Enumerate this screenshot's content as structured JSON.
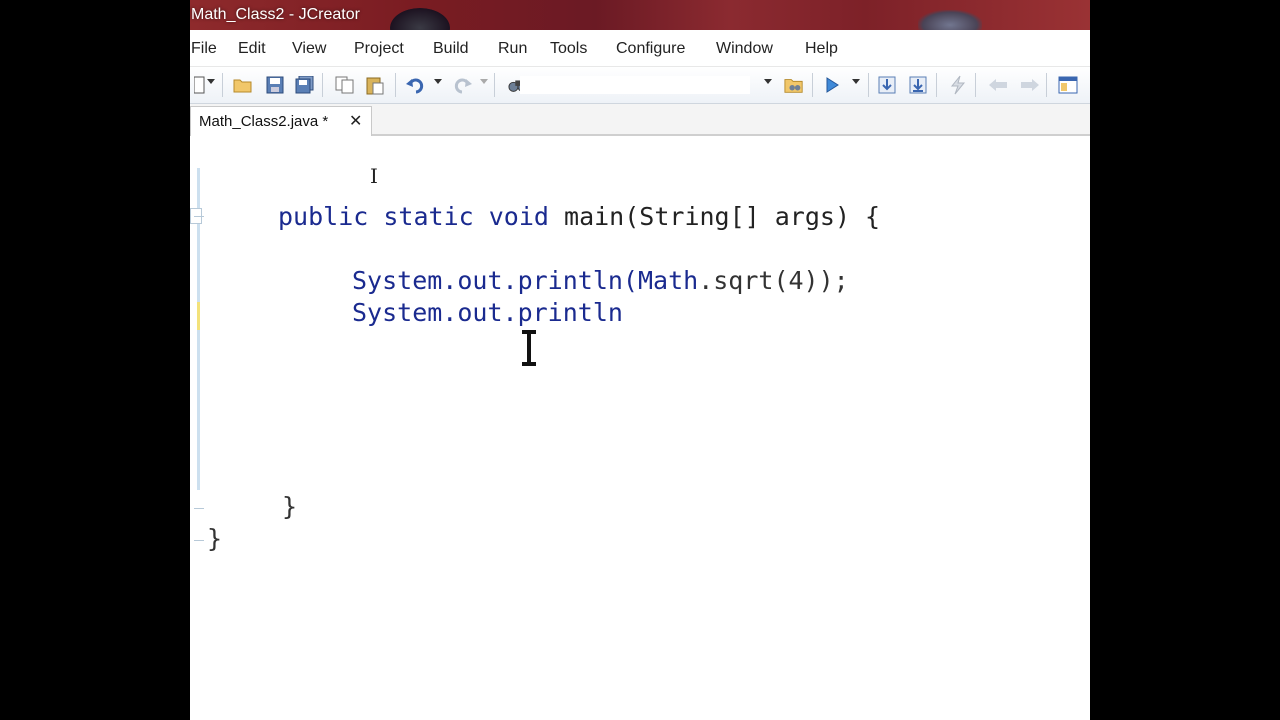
{
  "window": {
    "title": "Math_Class2 - JCreator"
  },
  "menu": {
    "items": [
      {
        "label": "File"
      },
      {
        "label": "Edit"
      },
      {
        "label": "View"
      },
      {
        "label": "Project"
      },
      {
        "label": "Build"
      },
      {
        "label": "Run"
      },
      {
        "label": "Tools"
      },
      {
        "label": "Configure"
      },
      {
        "label": "Window"
      },
      {
        "label": "Help"
      }
    ]
  },
  "toolbar": {
    "icons": [
      "new-file-icon",
      "open-folder-icon",
      "save-icon",
      "save-all-icon",
      "copy-icon",
      "paste-icon",
      "undo-icon",
      "redo-icon",
      "find-icon",
      "find-in-files-icon",
      "run-icon",
      "step-in-icon",
      "step-out-icon",
      "compile-icon",
      "back-icon",
      "forward-icon",
      "window-icon"
    ]
  },
  "tabs": [
    {
      "label": "Math_Class2.java *",
      "close": "✕"
    }
  ],
  "editor": {
    "lines": {
      "main_sig": {
        "kw1": "public",
        "kw2": "static",
        "kw3": "void",
        "rest": "main(String[] args) {"
      },
      "line1": {
        "prefix": "System.out.println(",
        "cls": "Math",
        "rest": ".sqrt(4));"
      },
      "line2": {
        "text": "System.out.println"
      },
      "close_method": "}",
      "close_class": "}"
    }
  },
  "colors": {
    "keyword": "#1a2a8f",
    "title_bar": "#7a1c22",
    "background": "#000000"
  }
}
